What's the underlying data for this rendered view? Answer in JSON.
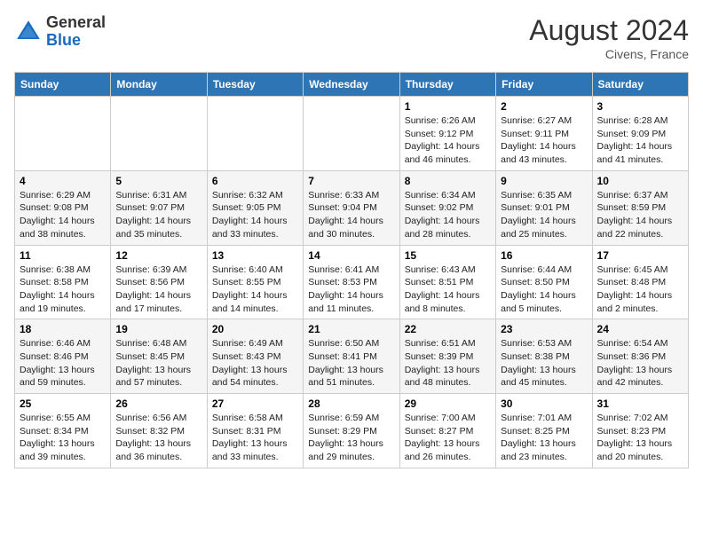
{
  "header": {
    "logo_general": "General",
    "logo_blue": "Blue",
    "month_year": "August 2024",
    "location": "Civens, France"
  },
  "days_of_week": [
    "Sunday",
    "Monday",
    "Tuesday",
    "Wednesday",
    "Thursday",
    "Friday",
    "Saturday"
  ],
  "weeks": [
    [
      {
        "day": "",
        "info": ""
      },
      {
        "day": "",
        "info": ""
      },
      {
        "day": "",
        "info": ""
      },
      {
        "day": "",
        "info": ""
      },
      {
        "day": "1",
        "info": "Sunrise: 6:26 AM\nSunset: 9:12 PM\nDaylight: 14 hours\nand 46 minutes."
      },
      {
        "day": "2",
        "info": "Sunrise: 6:27 AM\nSunset: 9:11 PM\nDaylight: 14 hours\nand 43 minutes."
      },
      {
        "day": "3",
        "info": "Sunrise: 6:28 AM\nSunset: 9:09 PM\nDaylight: 14 hours\nand 41 minutes."
      }
    ],
    [
      {
        "day": "4",
        "info": "Sunrise: 6:29 AM\nSunset: 9:08 PM\nDaylight: 14 hours\nand 38 minutes."
      },
      {
        "day": "5",
        "info": "Sunrise: 6:31 AM\nSunset: 9:07 PM\nDaylight: 14 hours\nand 35 minutes."
      },
      {
        "day": "6",
        "info": "Sunrise: 6:32 AM\nSunset: 9:05 PM\nDaylight: 14 hours\nand 33 minutes."
      },
      {
        "day": "7",
        "info": "Sunrise: 6:33 AM\nSunset: 9:04 PM\nDaylight: 14 hours\nand 30 minutes."
      },
      {
        "day": "8",
        "info": "Sunrise: 6:34 AM\nSunset: 9:02 PM\nDaylight: 14 hours\nand 28 minutes."
      },
      {
        "day": "9",
        "info": "Sunrise: 6:35 AM\nSunset: 9:01 PM\nDaylight: 14 hours\nand 25 minutes."
      },
      {
        "day": "10",
        "info": "Sunrise: 6:37 AM\nSunset: 8:59 PM\nDaylight: 14 hours\nand 22 minutes."
      }
    ],
    [
      {
        "day": "11",
        "info": "Sunrise: 6:38 AM\nSunset: 8:58 PM\nDaylight: 14 hours\nand 19 minutes."
      },
      {
        "day": "12",
        "info": "Sunrise: 6:39 AM\nSunset: 8:56 PM\nDaylight: 14 hours\nand 17 minutes."
      },
      {
        "day": "13",
        "info": "Sunrise: 6:40 AM\nSunset: 8:55 PM\nDaylight: 14 hours\nand 14 minutes."
      },
      {
        "day": "14",
        "info": "Sunrise: 6:41 AM\nSunset: 8:53 PM\nDaylight: 14 hours\nand 11 minutes."
      },
      {
        "day": "15",
        "info": "Sunrise: 6:43 AM\nSunset: 8:51 PM\nDaylight: 14 hours\nand 8 minutes."
      },
      {
        "day": "16",
        "info": "Sunrise: 6:44 AM\nSunset: 8:50 PM\nDaylight: 14 hours\nand 5 minutes."
      },
      {
        "day": "17",
        "info": "Sunrise: 6:45 AM\nSunset: 8:48 PM\nDaylight: 14 hours\nand 2 minutes."
      }
    ],
    [
      {
        "day": "18",
        "info": "Sunrise: 6:46 AM\nSunset: 8:46 PM\nDaylight: 13 hours\nand 59 minutes."
      },
      {
        "day": "19",
        "info": "Sunrise: 6:48 AM\nSunset: 8:45 PM\nDaylight: 13 hours\nand 57 minutes."
      },
      {
        "day": "20",
        "info": "Sunrise: 6:49 AM\nSunset: 8:43 PM\nDaylight: 13 hours\nand 54 minutes."
      },
      {
        "day": "21",
        "info": "Sunrise: 6:50 AM\nSunset: 8:41 PM\nDaylight: 13 hours\nand 51 minutes."
      },
      {
        "day": "22",
        "info": "Sunrise: 6:51 AM\nSunset: 8:39 PM\nDaylight: 13 hours\nand 48 minutes."
      },
      {
        "day": "23",
        "info": "Sunrise: 6:53 AM\nSunset: 8:38 PM\nDaylight: 13 hours\nand 45 minutes."
      },
      {
        "day": "24",
        "info": "Sunrise: 6:54 AM\nSunset: 8:36 PM\nDaylight: 13 hours\nand 42 minutes."
      }
    ],
    [
      {
        "day": "25",
        "info": "Sunrise: 6:55 AM\nSunset: 8:34 PM\nDaylight: 13 hours\nand 39 minutes."
      },
      {
        "day": "26",
        "info": "Sunrise: 6:56 AM\nSunset: 8:32 PM\nDaylight: 13 hours\nand 36 minutes."
      },
      {
        "day": "27",
        "info": "Sunrise: 6:58 AM\nSunset: 8:31 PM\nDaylight: 13 hours\nand 33 minutes."
      },
      {
        "day": "28",
        "info": "Sunrise: 6:59 AM\nSunset: 8:29 PM\nDaylight: 13 hours\nand 29 minutes."
      },
      {
        "day": "29",
        "info": "Sunrise: 7:00 AM\nSunset: 8:27 PM\nDaylight: 13 hours\nand 26 minutes."
      },
      {
        "day": "30",
        "info": "Sunrise: 7:01 AM\nSunset: 8:25 PM\nDaylight: 13 hours\nand 23 minutes."
      },
      {
        "day": "31",
        "info": "Sunrise: 7:02 AM\nSunset: 8:23 PM\nDaylight: 13 hours\nand 20 minutes."
      }
    ]
  ]
}
